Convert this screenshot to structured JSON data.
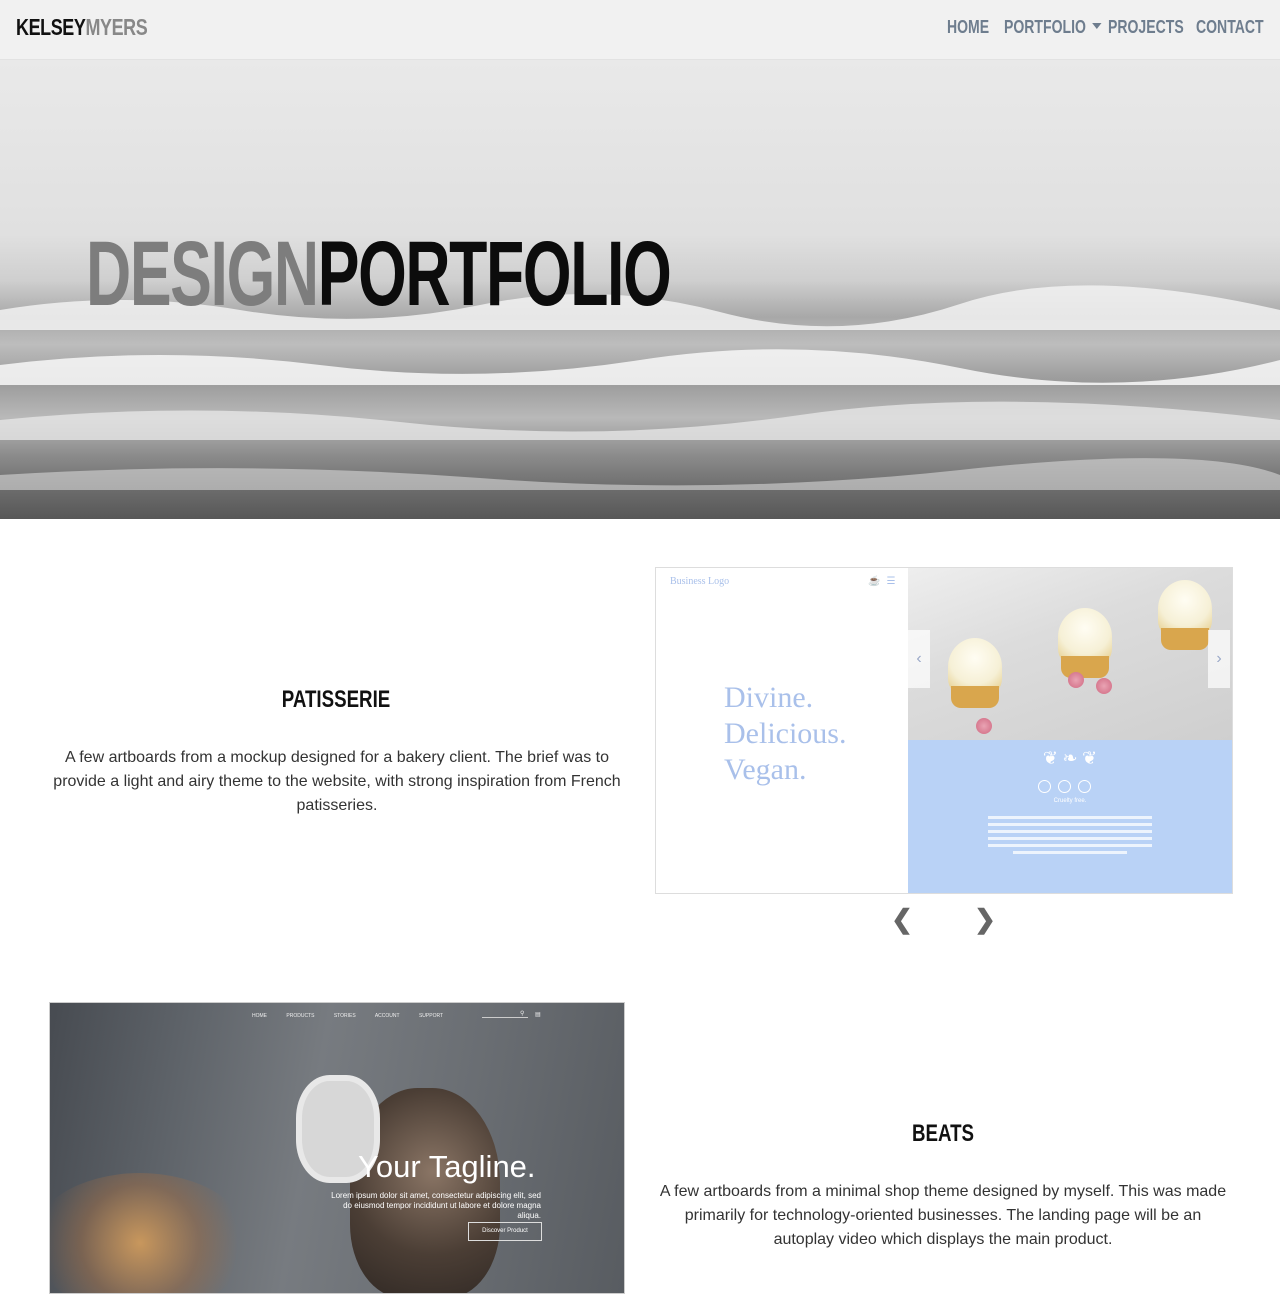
{
  "nav": {
    "brand_first": "KELSEY",
    "brand_last": "MYERS",
    "links": [
      {
        "label": "HOME"
      },
      {
        "label": "PORTFOLIO"
      },
      {
        "label": "PROJECTS"
      },
      {
        "label": "CONTACT"
      }
    ]
  },
  "hero": {
    "title_light": "DESIGN",
    "title_dark": "PORTFOLIO"
  },
  "projects": [
    {
      "title": "PATISSERIE",
      "description": "A few artboards from a mockup designed for a bakery client. The brief was to provide a light and airy theme to the website, with strong inspiration from French patisseries.",
      "mockup": {
        "logo": "Business Logo",
        "tagline": [
          "Divine.",
          "Delicious.",
          "Vegan."
        ],
        "caption": "Cruelty free."
      }
    },
    {
      "title": "BEATS",
      "description": "A few artboards from a minimal shop theme designed by myself. This was made primarily for technology-oriented businesses. The landing page will be an autoplay video which displays the main product.",
      "mockup": {
        "nav": [
          "HOME",
          "PRODUCTS",
          "STORIES",
          "ACCOUNT",
          "SUPPORT"
        ],
        "tagline": "Your Tagline.",
        "body": "Lorem ipsum dolor sit amet, consectetur adipiscing elit, sed do eiusmod tempor incididunt ut labore et dolore magna aliqua.",
        "button": "Discover Product"
      }
    }
  ],
  "colors": {
    "nav_bg": "#f1f1f1",
    "nav_link": "#6e7d8e",
    "accent_blue": "#b9d2f6"
  }
}
